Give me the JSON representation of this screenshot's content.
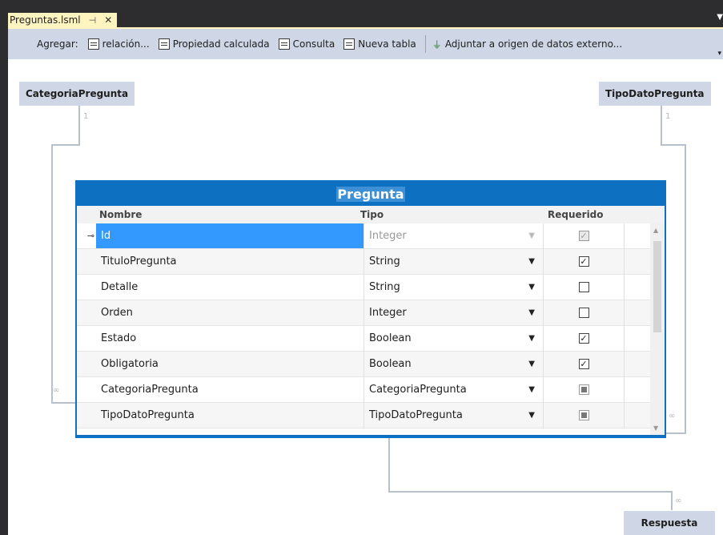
{
  "tab": {
    "title": "Preguntas.lsml",
    "pin_icon": "pin-icon",
    "close_icon": "close-icon"
  },
  "toolbar": {
    "label": "Agregar:",
    "buttons": [
      {
        "label": "relación...",
        "icon": "relation-icon"
      },
      {
        "label": "Propiedad calculada",
        "icon": "computed-property-icon"
      },
      {
        "label": "Consulta",
        "icon": "query-icon"
      },
      {
        "label": "Nueva tabla",
        "icon": "table-icon"
      }
    ],
    "attach_label": "Adjuntar a origen de datos externo..."
  },
  "entities": {
    "categoria": {
      "name": "CategoriaPregunta",
      "mult": "1"
    },
    "tipo_dato": {
      "name": "TipoDatoPregunta",
      "mult": "1"
    },
    "respuesta": {
      "name": "Respuesta",
      "mult": "∞"
    },
    "left_mult": "∞",
    "right_mult": "∞"
  },
  "table": {
    "title": "Pregunta",
    "columns": {
      "name": "Nombre",
      "type": "Tipo",
      "required": "Requerido"
    },
    "rows": [
      {
        "name": "Id",
        "type": "Integer",
        "required": "checked-disabled",
        "selected": true
      },
      {
        "name": "TituloPregunta",
        "type": "String",
        "required": "checked"
      },
      {
        "name": "Detalle",
        "type": "String",
        "required": "unchecked"
      },
      {
        "name": "Orden",
        "type": "Integer",
        "required": "unchecked"
      },
      {
        "name": "Estado",
        "type": "Boolean",
        "required": "checked"
      },
      {
        "name": "Obligatoria",
        "type": "Boolean",
        "required": "checked"
      },
      {
        "name": "CategoriaPregunta",
        "type": "CategoriaPregunta",
        "required": "indeterminate"
      },
      {
        "name": "TipoDatoPregunta",
        "type": "TipoDatoPregunta",
        "required": "indeterminate"
      }
    ]
  },
  "colors": {
    "accent": "#0e70c0",
    "selection": "#3399ff",
    "entity_bg": "#cfd6e5",
    "tab_bg": "#fdf4bf"
  }
}
